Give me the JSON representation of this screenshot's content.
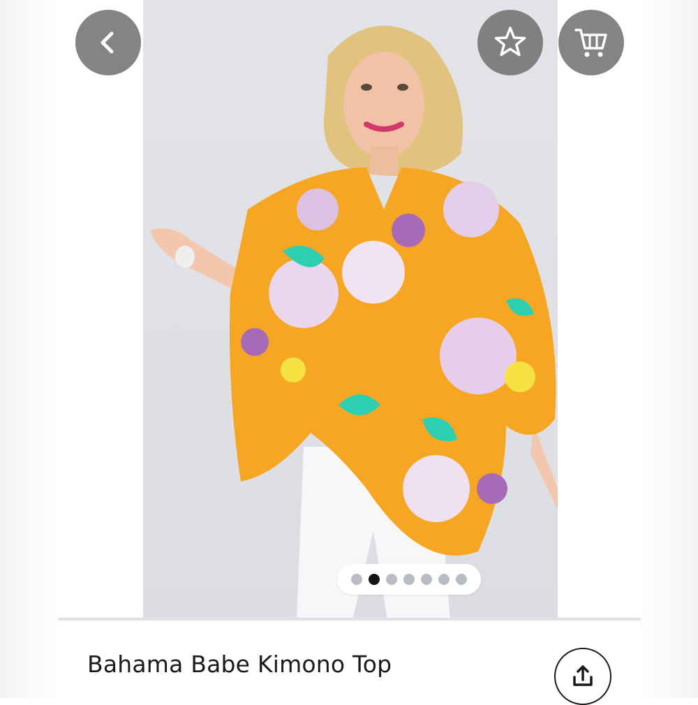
{
  "header": {
    "back_icon": "chevron-left-icon",
    "like_icon": "star-outline-icon",
    "cart_icon": "shopping-cart-icon",
    "button_color": "#6e6e6e"
  },
  "gallery": {
    "image_description_icon": "product-photo",
    "dot_count": 7,
    "active_index": 1
  },
  "product": {
    "title": "Bahama Babe Kimono Top",
    "share_icon": "share-upload-icon"
  },
  "colors": {
    "accent_orange": "#f6a623",
    "floral_teal": "#2ecfb0",
    "floral_lilac": "#c99ad8"
  }
}
